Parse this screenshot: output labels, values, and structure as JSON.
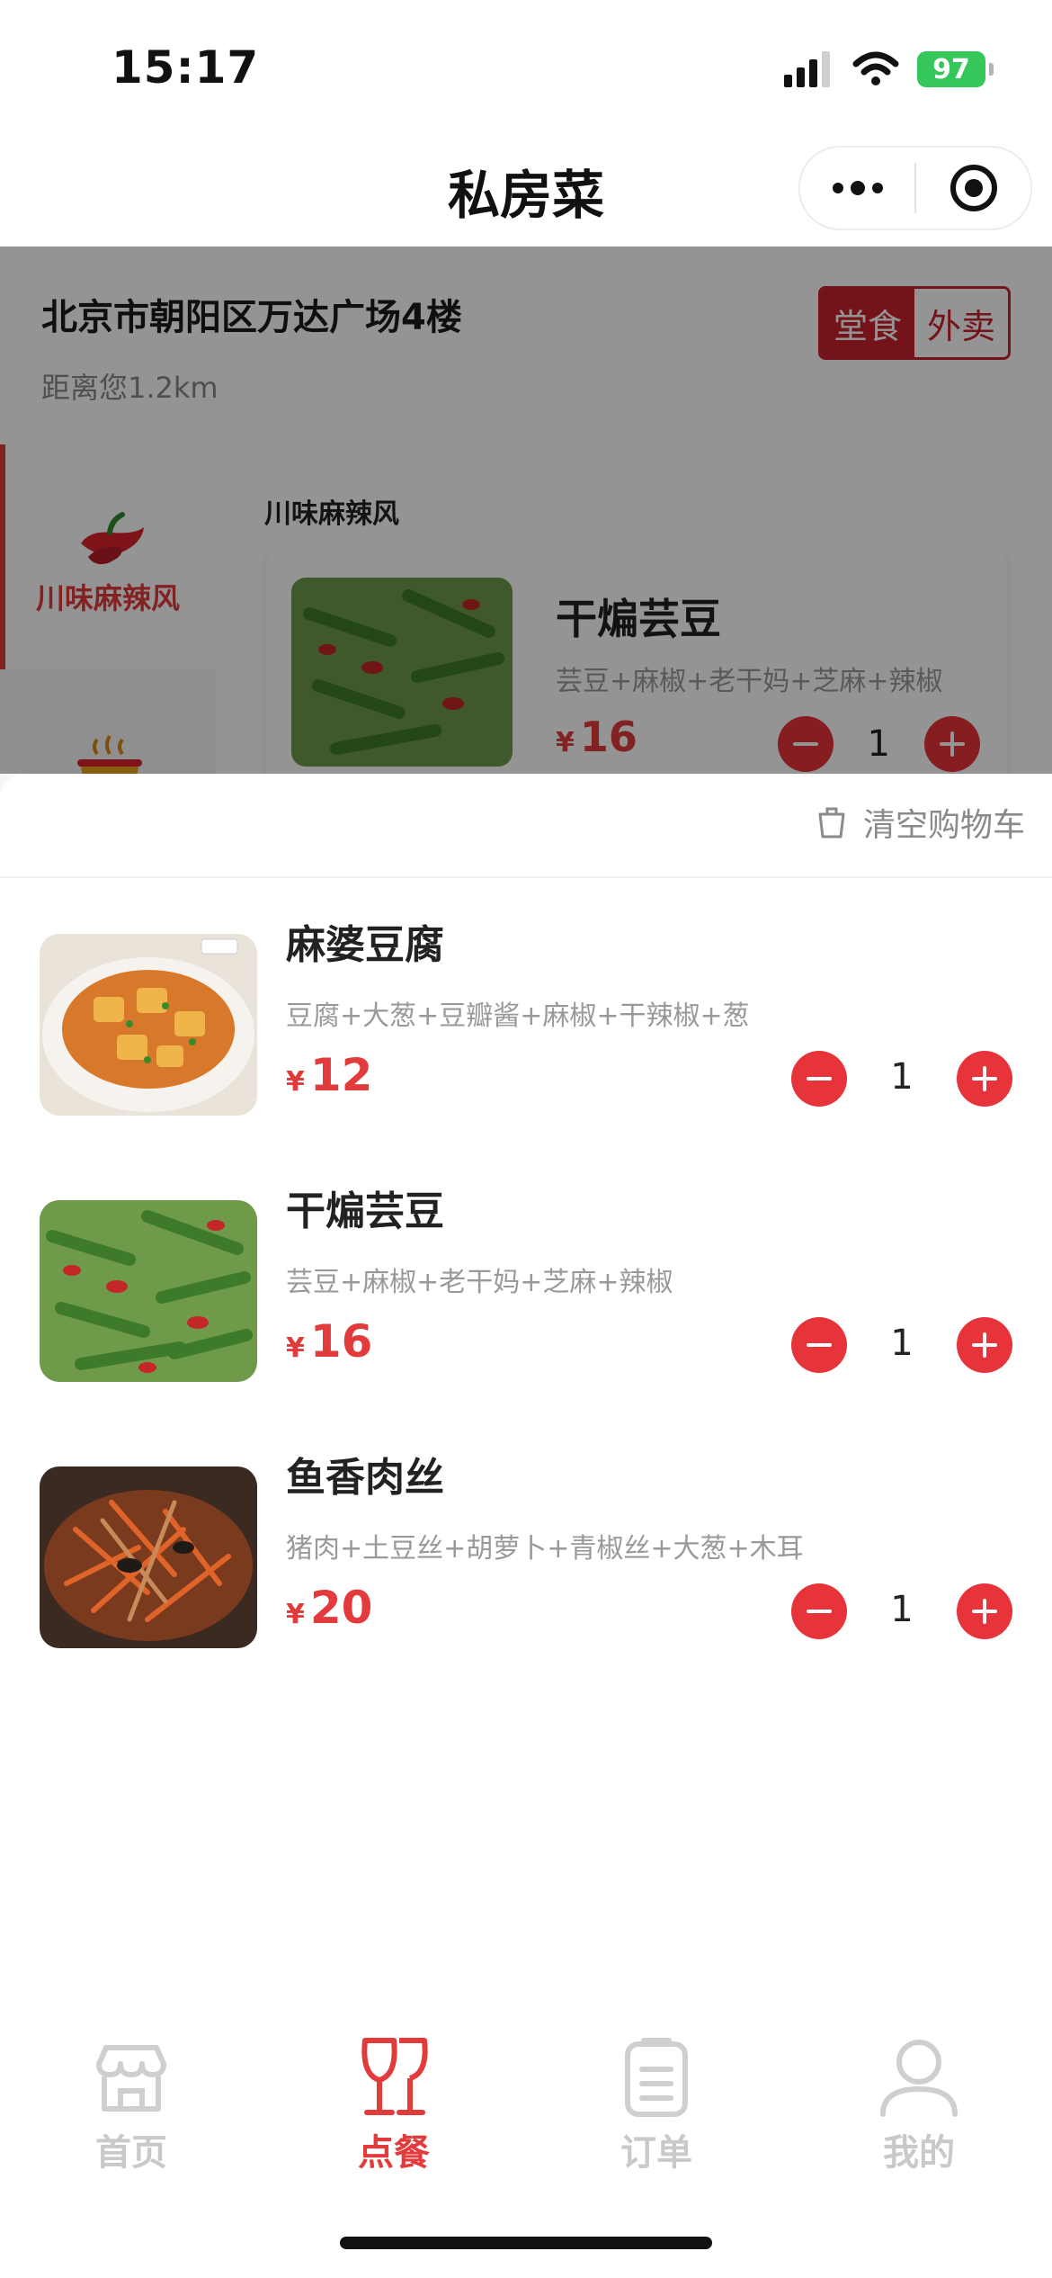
{
  "status_bar": {
    "time": "15:17",
    "battery": "97"
  },
  "nav": {
    "title": "私房菜",
    "more_icon": "more-dots-icon",
    "close_icon": "target-icon"
  },
  "store": {
    "address": "北京市朝阳区万达广场4楼",
    "distance": "距离您1.2km",
    "mode_dine_in": "堂食",
    "mode_takeout": "外卖",
    "active_mode": "堂食"
  },
  "categories": [
    {
      "label": "川味麻辣风",
      "icon": "chili-pepper-icon",
      "active": true
    },
    {
      "label": "",
      "icon": "hot-pot-icon",
      "active": false
    }
  ],
  "menu": {
    "section_title": "川味麻辣风",
    "item": {
      "name": "干煸芸豆",
      "desc": "芸豆+麻椒+老干妈+芝麻+辣椒",
      "currency": "¥",
      "price": "16",
      "qty": "1"
    }
  },
  "cart": {
    "clear_label": "清空购物车",
    "items": [
      {
        "name": "麻婆豆腐",
        "desc": "豆腐+大葱+豆瓣酱+麻椒+干辣椒+葱",
        "currency": "¥",
        "price": "12",
        "qty": "1"
      },
      {
        "name": "干煸芸豆",
        "desc": "芸豆+麻椒+老干妈+芝麻+辣椒",
        "currency": "¥",
        "price": "16",
        "qty": "1"
      },
      {
        "name": "鱼香肉丝",
        "desc": "猪肉+土豆丝+胡萝卜+青椒丝+大葱+木耳",
        "currency": "¥",
        "price": "20",
        "qty": "1"
      }
    ]
  },
  "tabs": [
    {
      "label": "首页",
      "icon": "store-icon",
      "active": false
    },
    {
      "label": "点餐",
      "icon": "wine-glasses-icon",
      "active": true
    },
    {
      "label": "订单",
      "icon": "order-list-icon",
      "active": false
    },
    {
      "label": "我的",
      "icon": "user-icon",
      "active": false
    }
  ],
  "colors": {
    "accent": "#e23b3b",
    "mode_red": "#c8232d",
    "success_green": "#35c759"
  }
}
